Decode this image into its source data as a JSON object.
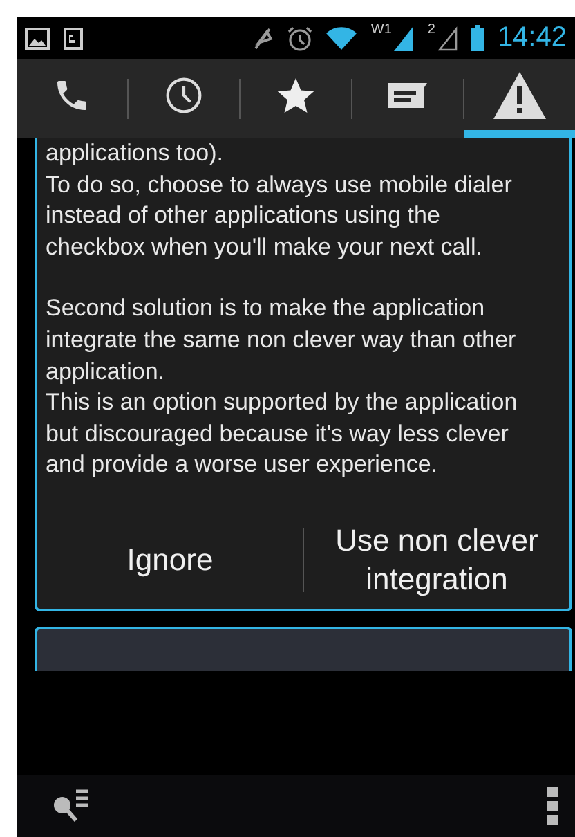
{
  "status_bar": {
    "network_label": "W1",
    "sim_label": "2",
    "time": "14:42"
  },
  "tabs": [
    {
      "kind": "phone",
      "selected": false
    },
    {
      "kind": "clock",
      "selected": false
    },
    {
      "kind": "star",
      "selected": false
    },
    {
      "kind": "message",
      "selected": false
    },
    {
      "kind": "warning",
      "selected": true
    }
  ],
  "card": {
    "paragraphs": [
      "applications too).\n To do so, choose to always use mobile dialer instead of other applications using the checkbox when you'll make your next call.",
      "Second solution is to make the application integrate the same non clever way than other application.\n This is an option supported by the application but discouraged because it's way less clever and provide a worse user experience."
    ],
    "buttons": [
      "Ignore",
      "Use non clever integration"
    ]
  }
}
